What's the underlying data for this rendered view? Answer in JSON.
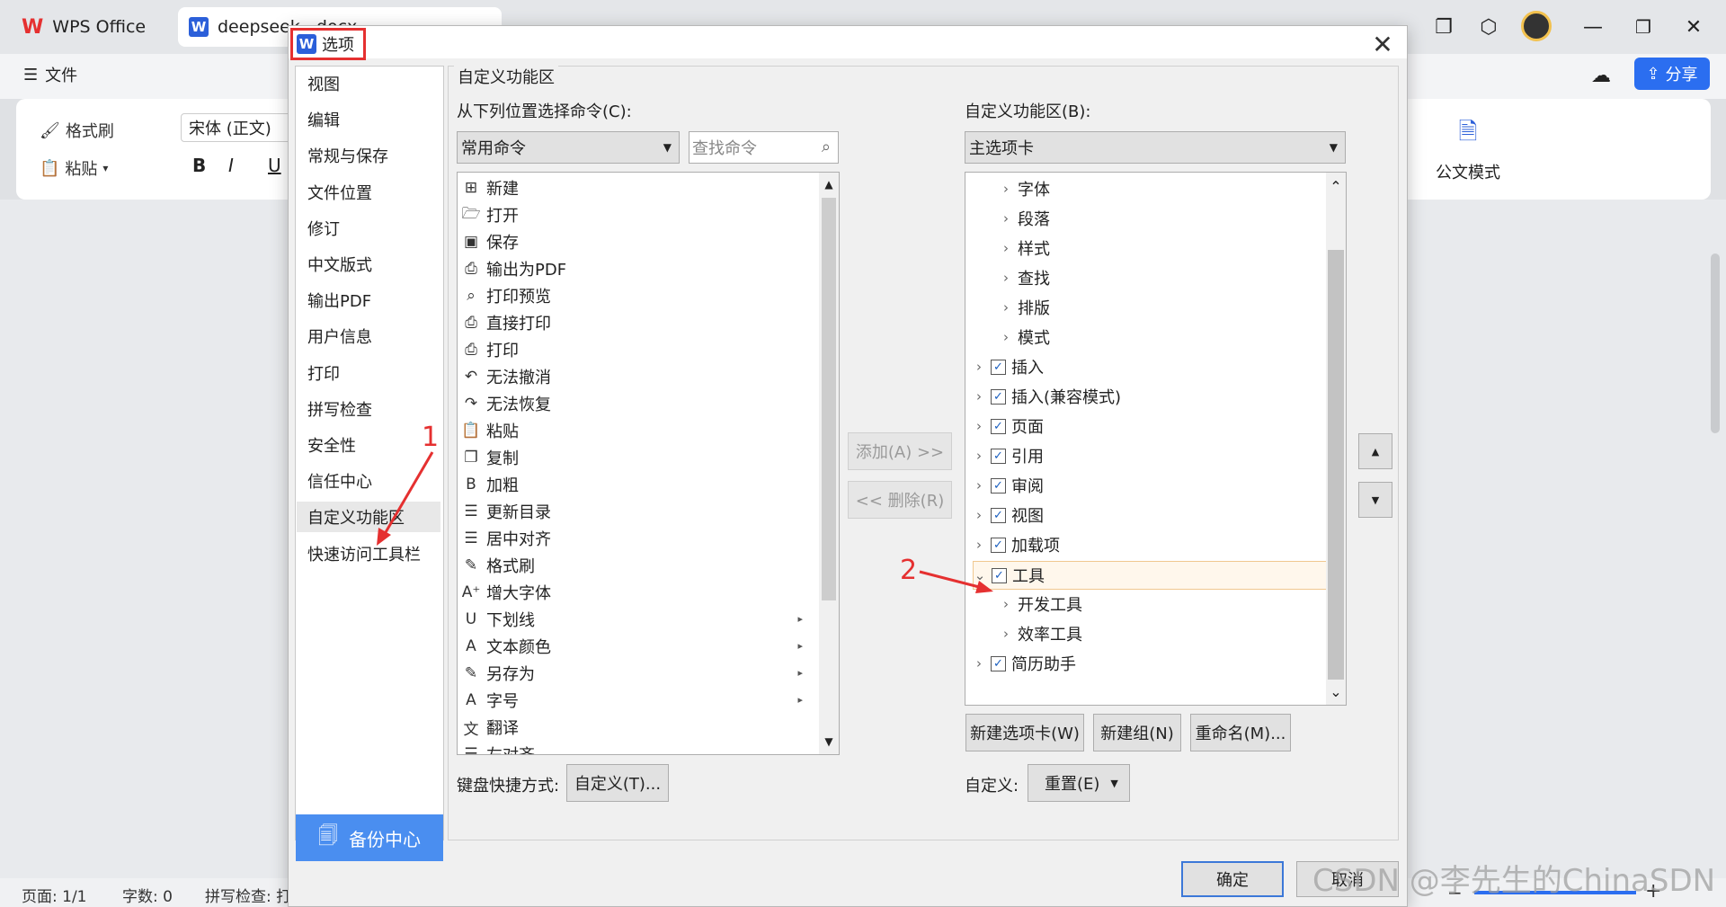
{
  "app": {
    "tabs": [
      {
        "label": "WPS Office"
      },
      {
        "label": "deepseek...docx"
      }
    ],
    "menu": {
      "file_label": "文件"
    },
    "ribbon": {
      "format_painter": "格式刷",
      "paste": "粘贴",
      "font_name": "宋体 (正文)",
      "bold": "B",
      "italic": "I",
      "underline": "U",
      "official_mode": "公文模式"
    },
    "share_label": "分享",
    "status": {
      "page": "页面: 1/1",
      "words": "字数: 0",
      "spell": "拼写检查: 打开"
    }
  },
  "dialog": {
    "title": "选项",
    "categories": [
      {
        "label": "视图"
      },
      {
        "label": "编辑"
      },
      {
        "label": "常规与保存"
      },
      {
        "label": "文件位置"
      },
      {
        "label": "修订"
      },
      {
        "label": "中文版式"
      },
      {
        "label": "输出PDF"
      },
      {
        "label": "用户信息"
      },
      {
        "label": "打印"
      },
      {
        "label": "拼写检查"
      },
      {
        "label": "安全性"
      },
      {
        "label": "信任中心"
      },
      {
        "label": "自定义功能区"
      },
      {
        "label": "快速访问工具栏"
      }
    ],
    "selected_category": "自定义功能区",
    "backup_center": "备份中心",
    "group_title": "自定义功能区",
    "choose_from_label": "从下列位置选择命令(C):",
    "choose_from_value": "常用命令",
    "search_placeholder": "查找命令",
    "commands": [
      {
        "label": "新建",
        "icon": "new-doc-icon",
        "glyph": "⊞"
      },
      {
        "label": "打开",
        "icon": "open-folder-icon",
        "glyph": "🗁"
      },
      {
        "label": "保存",
        "icon": "save-icon",
        "glyph": "▣"
      },
      {
        "label": "输出为PDF",
        "icon": "pdf-icon",
        "glyph": "⎙"
      },
      {
        "label": "打印预览",
        "icon": "print-preview-icon",
        "glyph": "⌕"
      },
      {
        "label": "直接打印",
        "icon": "direct-print-icon",
        "glyph": "⎙"
      },
      {
        "label": "打印",
        "icon": "print-icon",
        "glyph": "⎙"
      },
      {
        "label": "无法撤消",
        "icon": "undo-icon",
        "glyph": "↶"
      },
      {
        "label": "无法恢复",
        "icon": "redo-icon",
        "glyph": "↷"
      },
      {
        "label": "粘贴",
        "icon": "paste-icon",
        "glyph": "📋"
      },
      {
        "label": "复制",
        "icon": "copy-icon",
        "glyph": "❐"
      },
      {
        "label": "加粗",
        "icon": "bold-icon",
        "glyph": "B"
      },
      {
        "label": "更新目录",
        "icon": "update-toc-icon",
        "glyph": "☰"
      },
      {
        "label": "居中对齐",
        "icon": "align-center-icon",
        "glyph": "☰"
      },
      {
        "label": "格式刷",
        "icon": "format-painter-icon",
        "glyph": "✎"
      },
      {
        "label": "增大字体",
        "icon": "grow-font-icon",
        "glyph": "A⁺"
      },
      {
        "label": "下划线",
        "icon": "underline-icon",
        "glyph": "U",
        "submenu": true
      },
      {
        "label": "文本颜色",
        "icon": "text-color-icon",
        "glyph": "A",
        "submenu": true
      },
      {
        "label": "另存为",
        "icon": "save-as-icon",
        "glyph": "✎",
        "submenu": true
      },
      {
        "label": "字号",
        "icon": "font-size-icon",
        "glyph": "A",
        "submenu": true
      },
      {
        "label": "翻译",
        "icon": "translate-icon",
        "glyph": "文"
      },
      {
        "label": "左对齐",
        "icon": "align-left-icon",
        "glyph": "☰"
      }
    ],
    "add_button": "添加(A) >>",
    "remove_button": "<< 删除(R)",
    "customize_label": "自定义功能区(B):",
    "customize_value": "主选项卡",
    "tree": [
      {
        "label": "字体",
        "level": 1,
        "checkbox": false
      },
      {
        "label": "段落",
        "level": 1,
        "checkbox": false
      },
      {
        "label": "样式",
        "level": 1,
        "checkbox": false
      },
      {
        "label": "查找",
        "level": 1,
        "checkbox": false
      },
      {
        "label": "排版",
        "level": 1,
        "checkbox": false
      },
      {
        "label": "模式",
        "level": 1,
        "checkbox": false
      },
      {
        "label": "插入",
        "level": 0,
        "checkbox": true
      },
      {
        "label": "插入(兼容模式)",
        "level": 0,
        "checkbox": true
      },
      {
        "label": "页面",
        "level": 0,
        "checkbox": true
      },
      {
        "label": "引用",
        "level": 0,
        "checkbox": true
      },
      {
        "label": "审阅",
        "level": 0,
        "checkbox": true
      },
      {
        "label": "视图",
        "level": 0,
        "checkbox": true
      },
      {
        "label": "加载项",
        "level": 0,
        "checkbox": true
      },
      {
        "label": "工具",
        "level": 0,
        "checkbox": true,
        "expanded": true,
        "selected": true
      },
      {
        "label": "开发工具",
        "level": 1,
        "checkbox": false
      },
      {
        "label": "效率工具",
        "level": 1,
        "checkbox": false
      },
      {
        "label": "简历助手",
        "level": 0,
        "checkbox": true
      }
    ],
    "new_tab_button": "新建选项卡(W)",
    "new_group_button": "新建组(N)",
    "rename_button": "重命名(M)...",
    "keyboard_label": "键盘快捷方式:",
    "keyboard_button": "自定义(T)...",
    "customize_reset_label": "自定义:",
    "reset_button": "重置(E)",
    "ok_button": "确定",
    "cancel_button": "取消"
  },
  "annotations": {
    "marker1": "1",
    "marker2": "2"
  },
  "watermark": "CSDN @李先生的ChinaSDN",
  "colors": {
    "accent": "#2b5fd9",
    "annotation": "#e53030",
    "selection_border": "#f0c890"
  }
}
